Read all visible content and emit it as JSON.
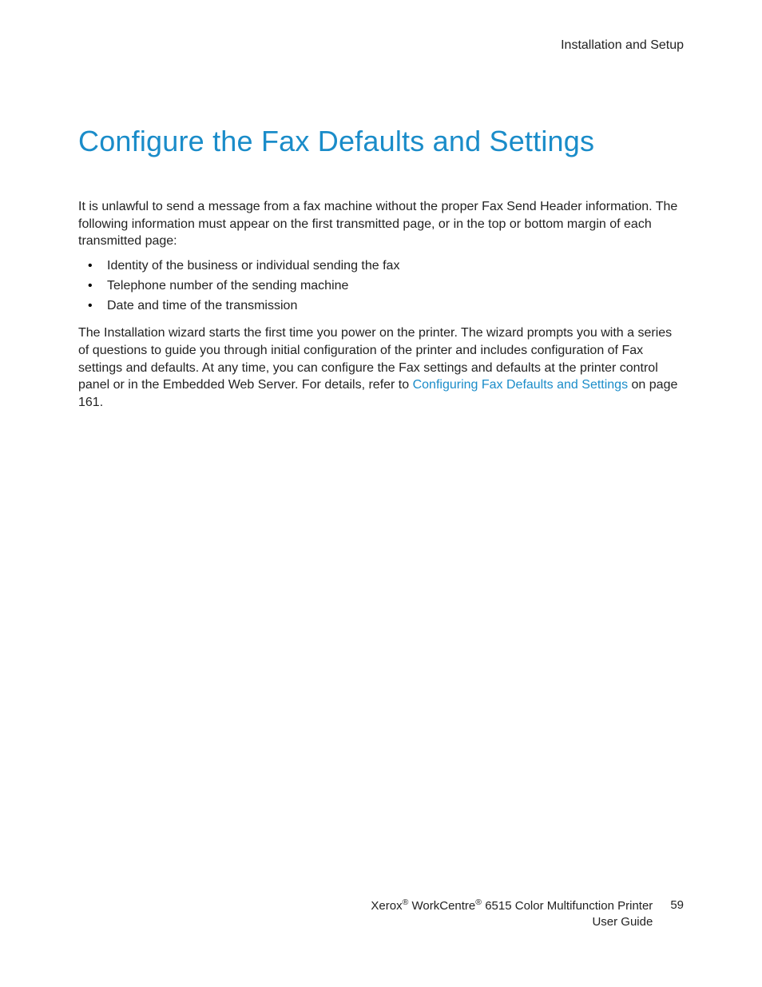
{
  "header": {
    "section": "Installation and Setup"
  },
  "title": "Configure the Fax Defaults and Settings",
  "intro": "It is unlawful to send a message from a fax machine without the proper Fax Send Header information. The following information must appear on the first transmitted page, or in the top or bottom margin of each transmitted page:",
  "bullets": [
    "Identity of the business or individual sending the fax",
    "Telephone number of the sending machine",
    "Date and time of the transmission"
  ],
  "body": {
    "pre_link": "The Installation wizard starts the first time you power on the printer. The wizard prompts you with a series of questions to guide you through initial configuration of the printer and includes configuration of Fax settings and defaults. At any time, you can configure the Fax settings and defaults at the printer control panel or in the Embedded Web Server. For details, refer to ",
    "link_text": "Configuring Fax Defaults and Settings",
    "post_link": " on page 161."
  },
  "footer": {
    "brand1": "Xerox",
    "reg1": "®",
    "brand2": " WorkCentre",
    "reg2": "®",
    "product_rest": " 6515 Color Multifunction Printer",
    "guide": "User Guide",
    "page_number": "59"
  }
}
